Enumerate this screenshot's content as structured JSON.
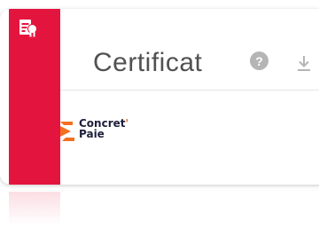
{
  "header": {
    "title": "Certificat",
    "help_symbol": "?",
    "icon": "certificate-icon"
  },
  "toolbar": {
    "help_icon": "help-icon",
    "download_icon": "download-icon"
  },
  "company_logo": {
    "line1": "Concret",
    "apostrophe": "'",
    "line2": "Paie"
  },
  "colors": {
    "accent": "#e3153f",
    "logo_orange": "#f36f21",
    "logo_text": "#1e1f3b",
    "title_text": "#515151",
    "icon_gray": "#b5b5b5"
  }
}
